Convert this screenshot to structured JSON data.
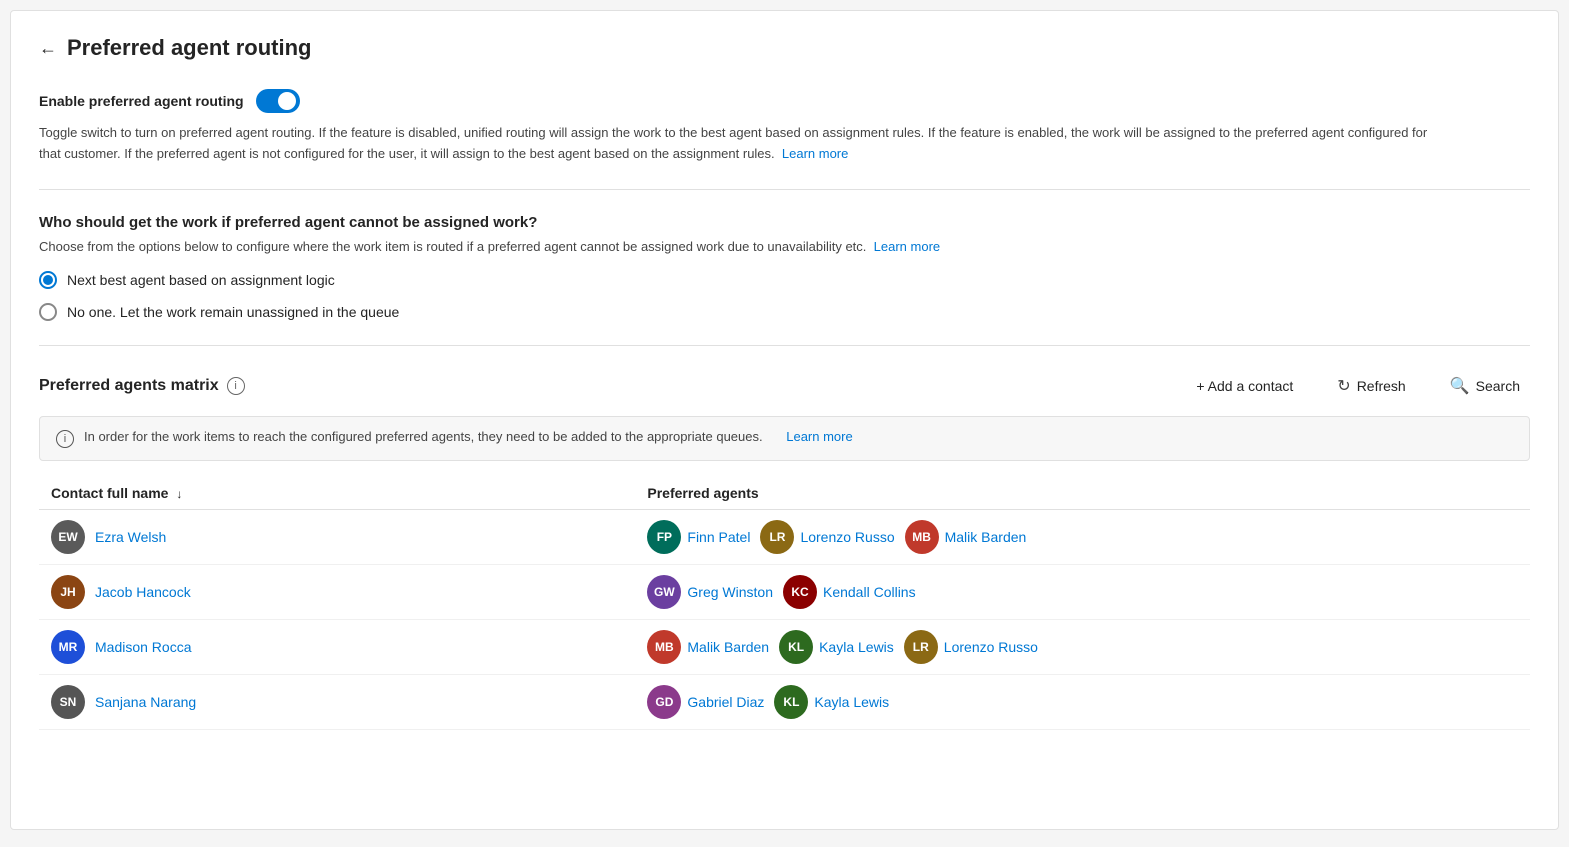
{
  "page": {
    "title": "Preferred agent routing",
    "back_label": "←"
  },
  "toggle_section": {
    "label": "Enable preferred agent routing",
    "enabled": true,
    "description": "Toggle switch to turn on preferred agent routing. If the feature is disabled, unified routing will assign the work to the best agent based on assignment rules. If the feature is enabled, the work will be assigned to the preferred agent configured for that customer. If the preferred agent is not configured for the user, it will assign to the best agent based on the assignment rules.",
    "learn_more": "Learn more"
  },
  "fallback_section": {
    "heading": "Who should get the work if preferred agent cannot be assigned work?",
    "description": "Choose from the options below to configure where the work item is routed if a preferred agent cannot be assigned work due to unavailability etc.",
    "learn_more": "Learn more",
    "options": [
      {
        "id": "next_best",
        "label": "Next best agent based on assignment logic",
        "selected": true
      },
      {
        "id": "no_one",
        "label": "No one. Let the work remain unassigned in the queue",
        "selected": false
      }
    ]
  },
  "matrix_section": {
    "title": "Preferred agents matrix",
    "info_tooltip": "i",
    "actions": {
      "add_contact": "+ Add a contact",
      "refresh": "Refresh",
      "search": "Search"
    },
    "info_banner": {
      "text": "In order for the work items to reach the configured preferred agents, they need to be added to the appropriate queues.",
      "learn_more": "Learn more"
    },
    "table": {
      "columns": [
        {
          "id": "contact",
          "label": "Contact full name",
          "sort": "↓"
        },
        {
          "id": "agents",
          "label": "Preferred agents"
        }
      ],
      "rows": [
        {
          "contact": {
            "initials": "EW",
            "name": "Ezra Welsh",
            "color": "#5a5a5a"
          },
          "agents": [
            {
              "initials": "FP",
              "name": "Finn Patel",
              "color": "#006d5b"
            },
            {
              "initials": "LR",
              "name": "Lorenzo Russo",
              "color": "#8b6914"
            },
            {
              "initials": "MB",
              "name": "Malik Barden",
              "color": "#c0392b"
            }
          ]
        },
        {
          "contact": {
            "initials": "JH",
            "name": "Jacob Hancock",
            "color": "#8b4513"
          },
          "agents": [
            {
              "initials": "GW",
              "name": "Greg Winston",
              "color": "#6b3fa0"
            },
            {
              "initials": "KC",
              "name": "Kendall Collins",
              "color": "#8b0000"
            }
          ]
        },
        {
          "contact": {
            "initials": "MR",
            "name": "Madison Rocca",
            "color": "#1e4fd8"
          },
          "agents": [
            {
              "initials": "MB",
              "name": "Malik Barden",
              "color": "#c0392b"
            },
            {
              "initials": "KL",
              "name": "Kayla Lewis",
              "color": "#2d6a1f"
            },
            {
              "initials": "LR",
              "name": "Lorenzo Russo",
              "color": "#8b6914"
            }
          ]
        },
        {
          "contact": {
            "initials": "SN",
            "name": "Sanjana Narang",
            "color": "#555"
          },
          "agents": [
            {
              "initials": "GD",
              "name": "Gabriel Diaz",
              "color": "#8b3a8b"
            },
            {
              "initials": "KL",
              "name": "Kayla Lewis",
              "color": "#2d6a1f"
            }
          ]
        }
      ]
    }
  }
}
